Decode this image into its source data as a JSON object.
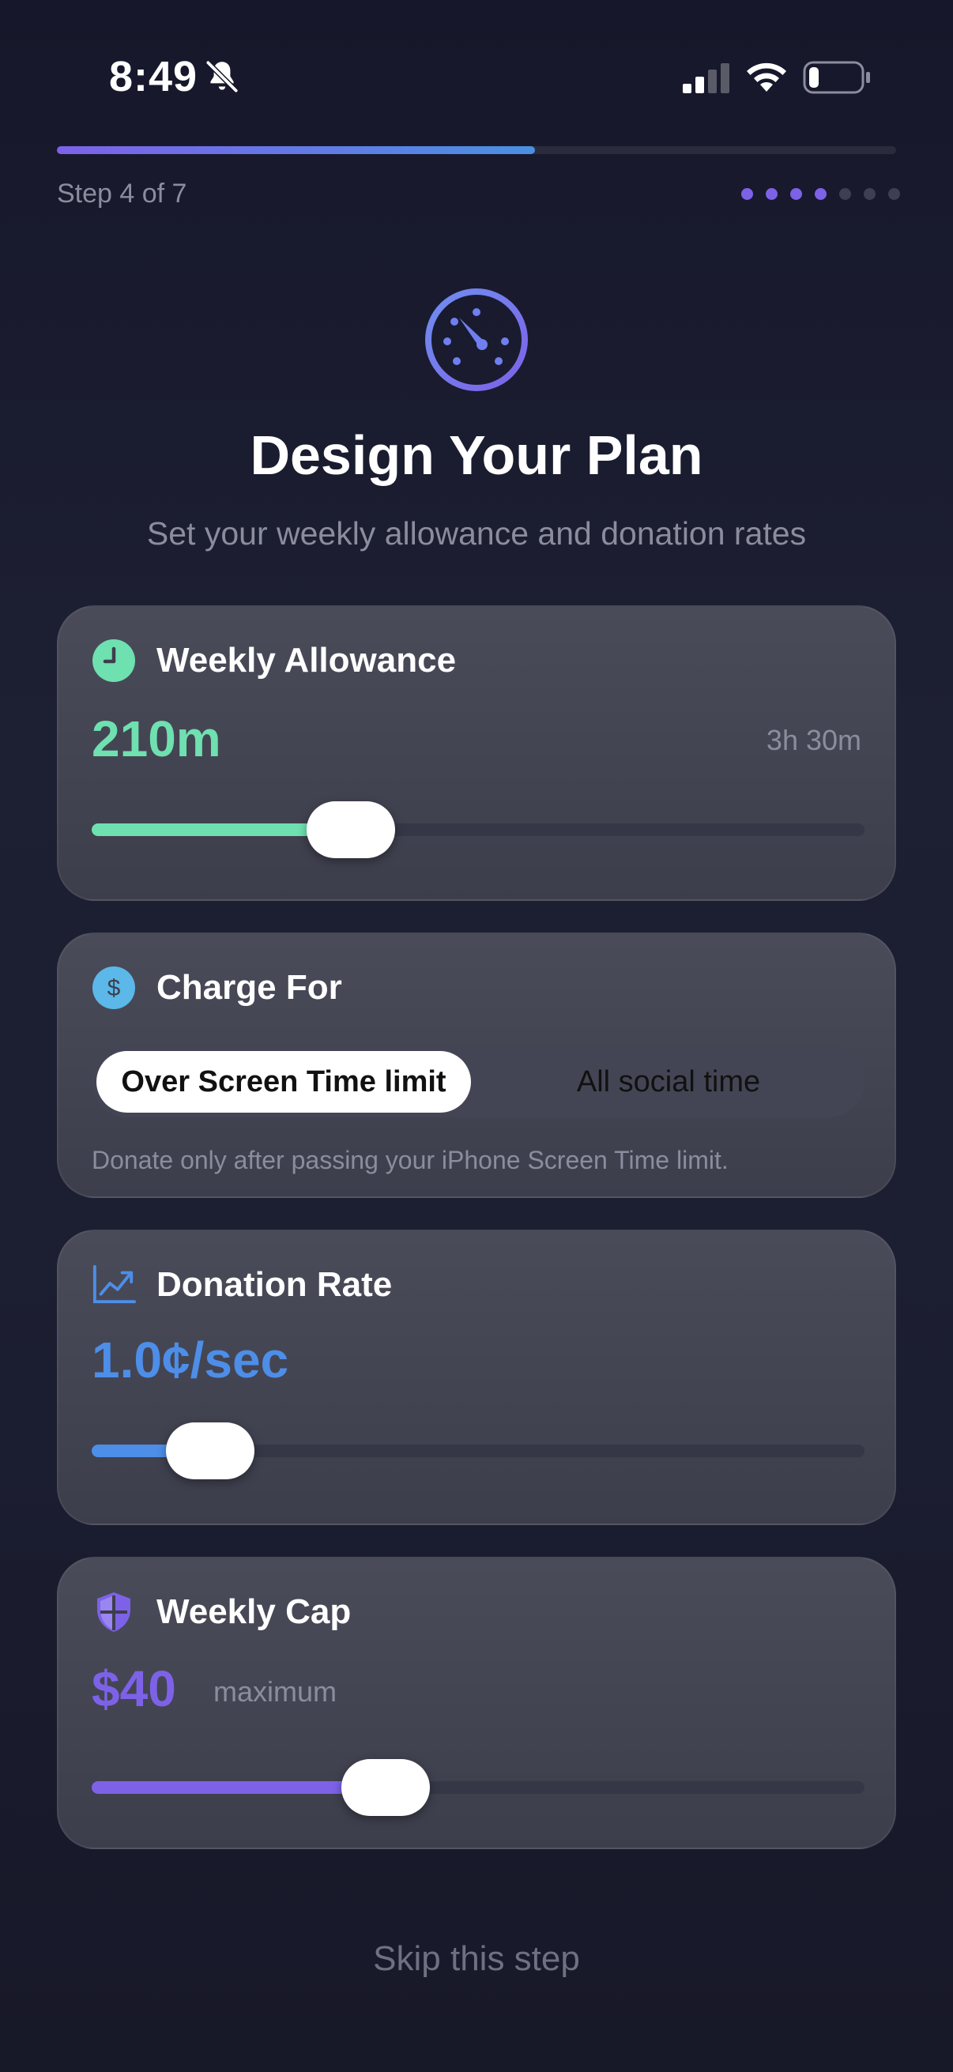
{
  "status_bar": {
    "time": "8:49",
    "icons": [
      "bell-slash-icon",
      "cellular-signal-icon",
      "wifi-icon",
      "battery-icon"
    ]
  },
  "progress": {
    "step_label": "Step 4 of 7",
    "current_step": 4,
    "total_steps": 7,
    "fill_fraction": 0.57,
    "accent_start": "#7d62e8",
    "accent_end": "#4a90e2"
  },
  "header": {
    "icon": "speedometer-icon",
    "title": "Design Your Plan",
    "subtitle": "Set your weekly allowance and donation rates"
  },
  "allowance": {
    "icon": "clock-icon",
    "title": "Weekly Allowance",
    "value": "210m",
    "secondary": "3h 30m",
    "slider_fraction": 0.335,
    "color": "#6fe0b0"
  },
  "charge_for": {
    "icon": "dollar-icon",
    "title": "Charge For",
    "options": [
      "Over Screen Time limit",
      "All social time"
    ],
    "selected": "Over Screen Time limit",
    "note": "Donate only after passing your iPhone Screen Time limit.",
    "color": "#5bb8e8"
  },
  "donation_rate": {
    "icon": "chart-line-icon",
    "title": "Donation Rate",
    "value": "1.0¢/sec",
    "slider_fraction": 0.153,
    "color": "#4d8ee8"
  },
  "weekly_cap": {
    "icon": "shield-icon",
    "title": "Weekly Cap",
    "value": "$40",
    "suffix": "maximum",
    "slider_fraction": 0.38,
    "color": "#7d62e8"
  },
  "footer": {
    "skip_label": "Skip this step"
  }
}
